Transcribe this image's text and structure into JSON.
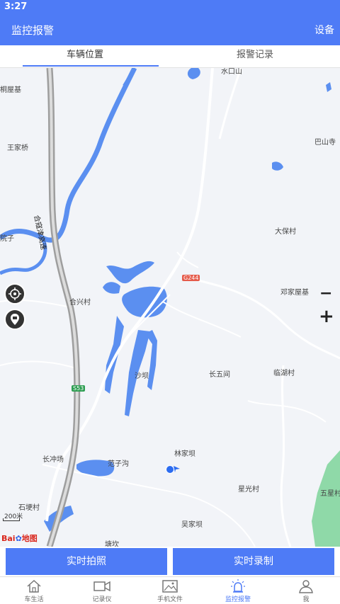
{
  "status_bar": {
    "time": "3:27"
  },
  "app_bar": {
    "title": "监控报警",
    "settings_label": "设备"
  },
  "tabs": [
    {
      "label": "车辆位置",
      "active": true
    },
    {
      "label": "报警记录",
      "active": false
    }
  ],
  "map": {
    "highway_name": "合寇津高速",
    "road_badges": [
      "G244",
      "S53"
    ],
    "places": {
      "p1": "水口山",
      "p2": "桐屋基",
      "p3": "王家桥",
      "p4": "巴山寺",
      "p5": "院子",
      "p6": "大保村",
      "p7": "合兴村",
      "p8": "邓家屋基",
      "p9": "沙坝",
      "p10": "长五间",
      "p11": "临湖村",
      "p12": "长冲场",
      "p13": "范子沟",
      "p14": "林家坝",
      "p15": "星光村",
      "p16": "石埂村",
      "p17": "吴家坝",
      "p18": "五星村",
      "p19": "塘坎"
    },
    "zoom_out": "−",
    "zoom_in": "+",
    "scale": "200米",
    "logo_prefix": "Bai",
    "logo_suffix": "地图",
    "colors": {
      "water": "#5b8ff0",
      "road": "#ffffff",
      "highway": "#9e9e9e",
      "vehicle": "#2c6cf0",
      "green": "#8fd9a8"
    }
  },
  "actions": {
    "photo": "实时拍照",
    "record": "实时录制"
  },
  "bottom_nav": [
    {
      "label": "车生活",
      "icon": "home-icon"
    },
    {
      "label": "记录仪",
      "icon": "camera-icon"
    },
    {
      "label": "手机文件",
      "icon": "image-icon"
    },
    {
      "label": "监控报警",
      "icon": "alarm-icon",
      "active": true
    },
    {
      "label": "我",
      "icon": "person-icon"
    }
  ]
}
